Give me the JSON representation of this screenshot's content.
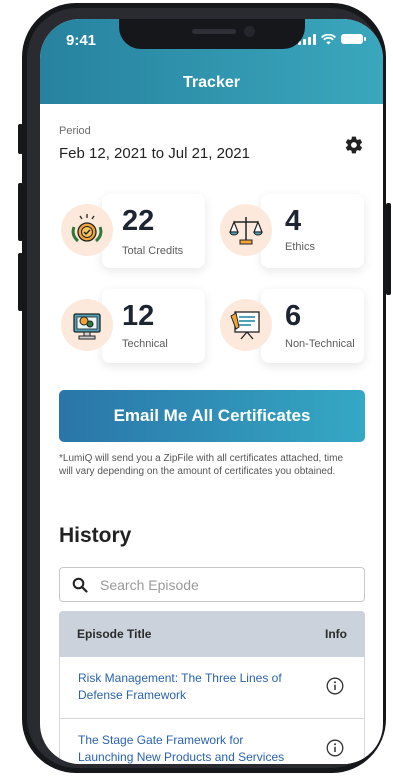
{
  "status_bar": {
    "time": "9:41"
  },
  "header": {
    "title": "Tracker"
  },
  "period": {
    "label": "Period",
    "value": "Feb 12, 2021 to Jul 21, 2021"
  },
  "stats": [
    {
      "value": "22",
      "label": "Total Credits",
      "icon": "badge-icon"
    },
    {
      "value": "4",
      "label": "Ethics",
      "icon": "scales-icon"
    },
    {
      "value": "12",
      "label": "Technical",
      "icon": "computer-icon"
    },
    {
      "value": "6",
      "label": "Non-Technical",
      "icon": "presentation-icon"
    }
  ],
  "email_button": {
    "label": "Email Me All Certificates"
  },
  "note": "*LumiQ will send you a ZipFile with all certificates attached, time will vary depending on the amount of certificates you obtained.",
  "history": {
    "title": "History",
    "search_placeholder": "Search Episode",
    "columns": {
      "title": "Episode Title",
      "info": "Info"
    },
    "rows": [
      {
        "title": "Risk Management: The Three Lines of Defense Framework"
      },
      {
        "title": "The Stage Gate Framework for Launching New Products and Services"
      }
    ]
  },
  "colors": {
    "header_gradient_start": "#27829f",
    "header_gradient_end": "#3aa7bd",
    "link": "#2a62ae",
    "icon_bg": "#fce9dc"
  }
}
